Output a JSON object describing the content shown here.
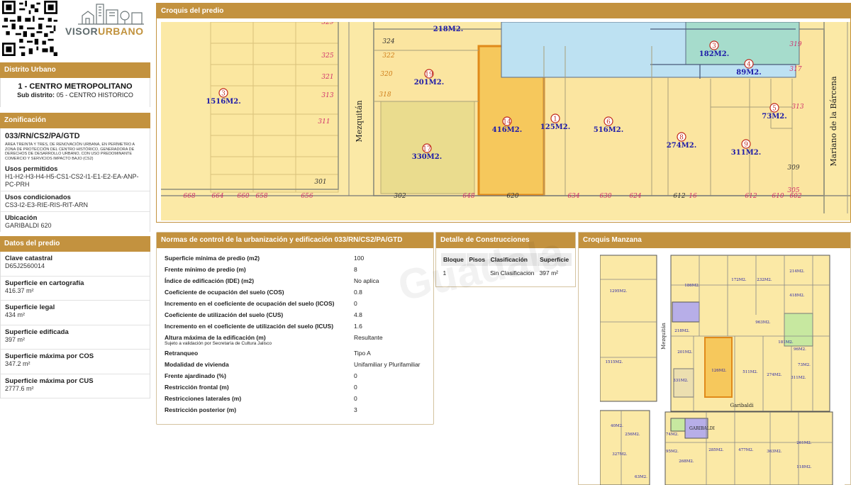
{
  "brand": {
    "part1": "VISOR",
    "part2": "URBANO"
  },
  "distrito": {
    "header": "Distrito Urbano",
    "name": "1 - CENTRO METROPOLITANO",
    "sub_label": "Sub distrito:",
    "sub_value": "05 - CENTRO HISTORICO"
  },
  "zonificacion": {
    "header": "Zonificación",
    "code": "033/RN/CS2/PA/GTD",
    "description": "ÁREA TREINTA Y TRES, DE RENOVACIÓN URBANA, EN PERÍMETRO A ZONA DE PROTECCIÓN DEL CENTRO HISTÓRICO, GENERADORA DE DERECHOS DE DESARROLLO URBANO, CON USO PREDOMINANTE COMERCIO Y SERVICIOS IMPACTO BAJO (CS2)",
    "usos_permitidos_label": "Usos permitidos",
    "usos_permitidos": "H1-H2-H3-H4-H5-CS1-CS2-I1-E1-E2-EA-ANP-PC-PRH",
    "usos_condicionados_label": "Usos condicionados",
    "usos_condicionados": "CS3-I2-E3-RIE-RIS-RIT-ARN",
    "ubicacion_label": "Ubicación",
    "ubicacion": "GARIBALDI 620"
  },
  "datos": {
    "header": "Datos del predio",
    "items": [
      {
        "label": "Clave catastral",
        "value": "D65J2560014"
      },
      {
        "label": "Superficie en cartografía",
        "value": "416.37 m²"
      },
      {
        "label": "Superficie legal",
        "value": "434 m²"
      },
      {
        "label": "Superficie edificada",
        "value": "397 m²"
      },
      {
        "label": "Superficie máxima por COS",
        "value": "347.2 m²"
      },
      {
        "label": "Superficie máxima por CUS",
        "value": "2777.6 m²"
      }
    ]
  },
  "croquis_predio": {
    "header": "Croquis del predio",
    "street_left": "Mezquitán",
    "street_right": "Mariano de la Bárcena",
    "lots": [
      {
        "n": "3",
        "area": "1516M2."
      },
      {
        "n": "19",
        "area": "201M2."
      },
      {
        "n": "17",
        "area": "330M2."
      },
      {
        "n": "14",
        "area": "416M2."
      },
      {
        "n": "1",
        "area": "125M2."
      },
      {
        "n": "6",
        "area": "516M2."
      },
      {
        "n": "8",
        "area": "274M2."
      },
      {
        "n": "9",
        "area": "311M2."
      },
      {
        "n": "3",
        "area": "182M2."
      },
      {
        "n": "4",
        "area": "89M2."
      },
      {
        "n": "5",
        "area": "73M2."
      }
    ],
    "top_area": "218M2.",
    "numbers_left": [
      "329",
      "325",
      "321",
      "313",
      "311",
      "301"
    ],
    "numbers_mid": [
      "324",
      "322",
      "320",
      "318"
    ],
    "numbers_right": [
      "319",
      "317",
      "313",
      "309",
      "305"
    ],
    "numbers_bottom": [
      "668",
      "664",
      "660",
      "658",
      "656",
      "302",
      "648",
      "620",
      "634",
      "630",
      "624",
      "612",
      "16",
      "612",
      "610",
      "602"
    ]
  },
  "normas": {
    "header": "Normas de control de la urbanización y edificación 033/RN/CS2/PA/GTD",
    "rows": [
      {
        "label": "Superficie mínima de predio (m2)",
        "note": "",
        "value": "100"
      },
      {
        "label": "Frente mínimo de predio (m)",
        "note": "",
        "value": "8"
      },
      {
        "label": "Índice de edificación (IDE) (m2)",
        "note": "",
        "value": "No aplica"
      },
      {
        "label": "Coeficiente de ocupación del suelo (COS)",
        "note": "",
        "value": "0.8"
      },
      {
        "label": "Incremento en el coeficiente de ocupación del suelo (ICOS)",
        "note": "",
        "value": "0"
      },
      {
        "label": "Coeficiente de utilización del suelo (CUS)",
        "note": "",
        "value": "4.8"
      },
      {
        "label": "Incremento en el coeficiente de utilización del suelo (ICUS)",
        "note": "",
        "value": "1.6"
      },
      {
        "label": "Altura máxima de la edificación (m)",
        "note": "Sujeto a validación por Secretaría de Cultura Jalisco",
        "value": "Resultante"
      },
      {
        "label": "Retranqueo",
        "note": "",
        "value": "Tipo A"
      },
      {
        "label": "Modalidad de vivienda",
        "note": "",
        "value": "Unifamiliar y Plurifamiliar"
      },
      {
        "label": "Frente ajardinado (%)",
        "note": "",
        "value": "0"
      },
      {
        "label": "Restricción frontal (m)",
        "note": "",
        "value": "0"
      },
      {
        "label": "Restricciones laterales (m)",
        "note": "",
        "value": "0"
      },
      {
        "label": "Restricción posterior (m)",
        "note": "",
        "value": "3"
      }
    ]
  },
  "detalle": {
    "header": "Detalle de Construcciones",
    "columns": [
      "Bloque",
      "Pisos",
      "Clasificación",
      "Superficie"
    ],
    "rows": [
      {
        "bloque": "1",
        "pisos": "",
        "clasificacion": "Sin Clasificacion",
        "superficie": "397 m²"
      }
    ]
  },
  "manzana": {
    "header": "Croquis Manzana",
    "street_bottom": "Garibaldi",
    "street_left": "Mezquitán",
    "labels": [
      "1295M2.",
      "186M2.",
      "172M2.",
      "232M2.",
      "214M2.",
      "418M2.",
      "963M2.",
      "218M2.",
      "181M2.",
      "96M2.",
      "73M2.",
      "201M2.",
      "1515M2.",
      "331M2.",
      "126M2.",
      "511M2.",
      "274M2.",
      "311M2.",
      "40M2.",
      "256M2.",
      "327M2.",
      "74M2.",
      "95M2.",
      "268M2.",
      "285M2.",
      "477M2.",
      "363M2.",
      "261M2.",
      "118M2.",
      "63M2."
    ],
    "bottom_label": "GARIBALDI"
  },
  "watermark": "Guadala"
}
